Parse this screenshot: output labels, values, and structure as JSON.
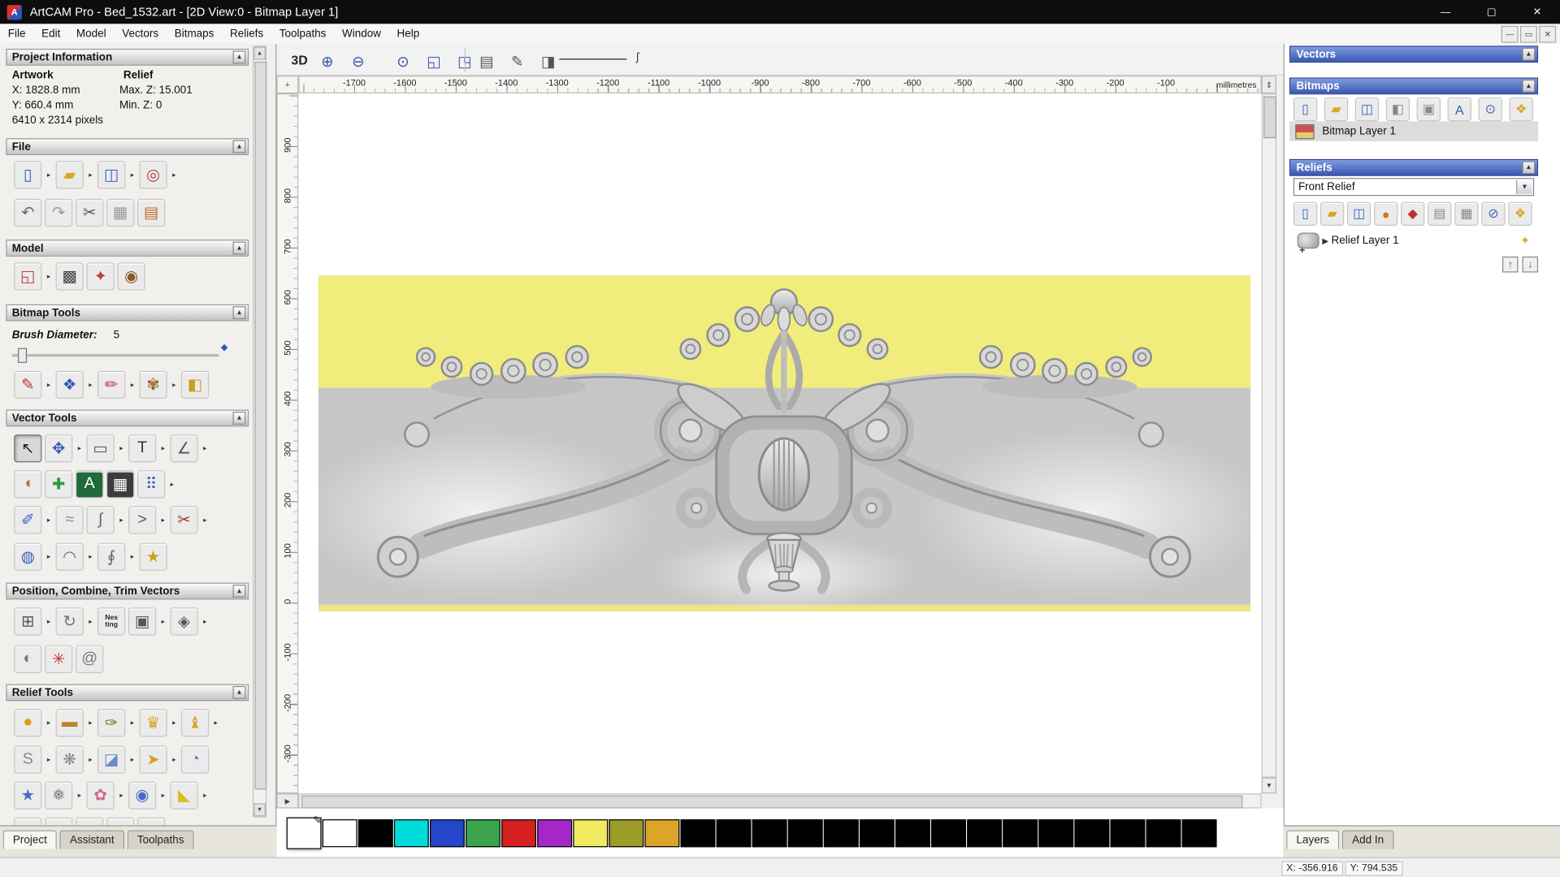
{
  "window": {
    "title": "ArtCAM Pro - Bed_1532.art - [2D View:0 - Bitmap Layer 1]",
    "menus": [
      "File",
      "Edit",
      "Model",
      "Vectors",
      "Bitmaps",
      "Reliefs",
      "Toolpaths",
      "Window",
      "Help"
    ],
    "controls": {
      "minimize": "—",
      "maximize": "▢",
      "close": "✕"
    },
    "mdi_controls": {
      "minimize": "—",
      "restore": "▭",
      "close": "✕"
    }
  },
  "left_panel": {
    "project_info": {
      "title": "Project Information",
      "artwork_label": "Artwork",
      "relief_label": "Relief",
      "x_value": "X: 1828.8 mm",
      "y_value": "Y: 660.4 mm",
      "pixels": "6410 x 2314 pixels",
      "max_z": "Max. Z: 15.001",
      "min_z": "Min. Z: 0"
    },
    "section_titles": {
      "file": "File",
      "model": "Model",
      "bitmap_tools": "Bitmap Tools",
      "vector_tools": "Vector Tools",
      "position_combine": "Position, Combine, Trim Vectors",
      "relief_tools": "Relief Tools"
    },
    "brush": {
      "label": "Brush Diameter:",
      "value": "5"
    },
    "icons": {
      "file_row1": [
        {
          "name": "new-model",
          "glyph": "▯",
          "fg": "#3a62c0",
          "dd": true
        },
        {
          "name": "open-model",
          "glyph": "▰",
          "fg": "#d8a826",
          "dd": true
        },
        {
          "name": "save-model",
          "glyph": "◫",
          "fg": "#3a62c0",
          "dd": true
        },
        {
          "name": "export-model",
          "glyph": "◎",
          "fg": "#b04040",
          "dd": true
        }
      ],
      "file_row2": [
        {
          "name": "undo",
          "glyph": "↶",
          "fg": "#6a6a6a"
        },
        {
          "name": "redo",
          "glyph": "↷",
          "fg": "#9a9a9a"
        },
        {
          "name": "cut",
          "glyph": "✂",
          "fg": "#555555"
        },
        {
          "name": "copy",
          "glyph": "▦",
          "fg": "#9a9a9a"
        },
        {
          "name": "paste",
          "glyph": "▤",
          "fg": "#c06a30"
        }
      ],
      "model_row": [
        {
          "name": "set-model-size",
          "glyph": "◱",
          "fg": "#c04040",
          "dd": true
        },
        {
          "name": "adjust-model",
          "glyph": "▩",
          "fg": "#404040"
        },
        {
          "name": "relief-clipart-library",
          "glyph": "✦",
          "fg": "#c04040"
        },
        {
          "name": "model-texture",
          "glyph": "◉",
          "fg": "#8a5a2a"
        }
      ],
      "bitmap_row": [
        {
          "name": "paint",
          "glyph": "✎",
          "fg": "#c03030",
          "dd": true
        },
        {
          "name": "paint-selective-colour",
          "glyph": "❖",
          "fg": "#3858b8",
          "dd": true
        },
        {
          "name": "pixel-edit",
          "glyph": "✏",
          "fg": "#b04040",
          "dd": true
        },
        {
          "name": "colour-palette",
          "glyph": "✾",
          "fg": "#9a6a2a",
          "dd": true
        },
        {
          "name": "flood-fill",
          "glyph": "◧",
          "fg": "#c8a020"
        }
      ],
      "vector_row1": [
        {
          "name": "select-vectors",
          "glyph": "↖",
          "fg": "#222222",
          "pressed": true
        },
        {
          "name": "transform-vectors",
          "glyph": "✥",
          "fg": "#3858b8",
          "dd": true
        },
        {
          "name": "create-rectangle",
          "glyph": "▭",
          "fg": "#555555",
          "dd": true
        },
        {
          "name": "create-text",
          "glyph": "T",
          "fg": "#333333",
          "dd": true
        },
        {
          "name": "measure",
          "glyph": "∠",
          "fg": "#555555",
          "dd": true
        }
      ],
      "vector_row2": [
        {
          "name": "create-vector-offset",
          "glyph": "◖",
          "fg": "#c07030"
        },
        {
          "name": "vector-doctor",
          "glyph": "✚",
          "fg": "#2a9a3a"
        },
        {
          "name": "convert-text-to-vectors",
          "glyph": "A",
          "fg": "#ffffff",
          "bg": "#1f6b3a"
        },
        {
          "name": "paste-along-curve",
          "glyph": "▦",
          "fg": "#ffffff",
          "bg": "#3c3c3c"
        },
        {
          "name": "block-copy",
          "glyph": "⠿",
          "fg": "#3858b8",
          "dd": true
        }
      ],
      "vector_row3": [
        {
          "name": "create-polyline",
          "glyph": "✐",
          "fg": "#3060c0",
          "dd": true
        },
        {
          "name": "fit-arcs",
          "glyph": "≈",
          "fg": "#909090"
        },
        {
          "name": "create-bezier",
          "glyph": "∫",
          "fg": "#666666",
          "dd": true
        },
        {
          "name": "join-close-vectors",
          "glyph": ">",
          "fg": "#555555",
          "dd": true
        },
        {
          "name": "trim-vectors",
          "glyph": "✂",
          "fg": "#a03030",
          "dd": true
        }
      ],
      "vector_row4": [
        {
          "name": "create-circle",
          "glyph": "◍",
          "fg": "#3a62b0",
          "dd": true
        },
        {
          "name": "create-arc",
          "glyph": "◠",
          "fg": "#666666",
          "dd": true
        },
        {
          "name": "node-editing",
          "glyph": "∮",
          "fg": "#666666",
          "dd": true
        },
        {
          "name": "create-star",
          "glyph": "★",
          "fg": "#c8a018"
        }
      ],
      "position_row1": [
        {
          "name": "align-vectors",
          "glyph": "⊞",
          "fg": "#555555",
          "dd": true
        },
        {
          "name": "paste-in-circle",
          "glyph": "↻",
          "fg": "#777777",
          "dd": true
        },
        {
          "name": "nesting",
          "glyph": "Nes\nting",
          "fg": "#222222",
          "small": true
        },
        {
          "name": "group-vectors",
          "glyph": "▣",
          "fg": "#555555",
          "dd": true
        },
        {
          "name": "weld-vectors",
          "glyph": "◈",
          "fg": "#555555",
          "dd": true
        }
      ],
      "position_row2": [
        {
          "name": "mirror-vectors",
          "glyph": "◐",
          "fg": "#777777"
        },
        {
          "name": "slice-vectors",
          "glyph": "✳",
          "fg": "#c03030"
        },
        {
          "name": "create-spiral",
          "glyph": "@",
          "fg": "#777777"
        }
      ],
      "relief_row1": [
        {
          "name": "shape-editor",
          "glyph": "●",
          "fg": "#d8a020",
          "dd": true
        },
        {
          "name": "smooth-relief",
          "glyph": "▬",
          "fg": "#b8862a",
          "dd": true
        },
        {
          "name": "sculpt",
          "glyph": "✑",
          "fg": "#8a6a2a",
          "dd": true
        },
        {
          "name": "add-relief-clipart",
          "glyph": "♛",
          "fg": "#d8a020",
          "dd": true
        },
        {
          "name": "spin-relief",
          "glyph": "♝",
          "fg": "#d8a020",
          "dd": true
        }
      ],
      "relief_row2": [
        {
          "name": "two-rail-sweep",
          "glyph": "S",
          "fg": "#888888",
          "dd": true
        },
        {
          "name": "weave-wizard",
          "glyph": "❋",
          "fg": "#888888",
          "dd": true
        },
        {
          "name": "envelope-distort",
          "glyph": "◪",
          "fg": "#6a8ac8",
          "dd": true
        },
        {
          "name": "extrude",
          "glyph": "➤",
          "fg": "#d8a020",
          "dd": true
        },
        {
          "name": "unwrap-relief",
          "glyph": "◔",
          "fg": "#6a8ac8"
        }
      ],
      "relief_row3": [
        {
          "name": "texture-star",
          "glyph": "★",
          "fg": "#4a6ac8"
        },
        {
          "name": "texture-relief",
          "glyph": "❅",
          "fg": "#888888",
          "dd": true
        },
        {
          "name": "feather-relief",
          "glyph": "✿",
          "fg": "#d06a8a",
          "dd": true
        },
        {
          "name": "isoform",
          "glyph": "◉",
          "fg": "#4a6ac8",
          "dd": true
        },
        {
          "name": "create-wedge",
          "glyph": "◣",
          "fg": "#d8c020",
          "dd": true
        }
      ],
      "relief_row4": [
        {
          "name": "offset-relief",
          "glyph": "●",
          "fg": "#c03030"
        },
        {
          "name": "greyscale-from-relief",
          "glyph": "▦",
          "fg": "#888888"
        },
        {
          "name": "relief-from-image",
          "glyph": "◍",
          "fg": "#4a6ac8"
        },
        {
          "name": "mirror-relief",
          "glyph": "◨",
          "fg": "#888888"
        },
        {
          "name": "combine-relief",
          "glyph": "◩",
          "fg": "#888888"
        }
      ]
    },
    "tabs": [
      {
        "label": "Project",
        "active": true
      },
      {
        "label": "Assistant",
        "active": false
      },
      {
        "label": "Toolpaths",
        "active": false
      }
    ]
  },
  "toolbar": {
    "mode_3d": "3D",
    "zoom_icons_a": [
      {
        "name": "zoom-in",
        "glyph": "⊕",
        "fg": "#3858a8"
      },
      {
        "name": "zoom-out",
        "glyph": "⊖",
        "fg": "#3858a8"
      }
    ],
    "zoom_icons_b": [
      {
        "name": "zoom-previous",
        "glyph": "⊙",
        "fg": "#3858a8"
      },
      {
        "name": "zoom-fit",
        "glyph": "◱",
        "fg": "#3858a8"
      },
      {
        "name": "zoom-objects",
        "glyph": "◳",
        "fg": "#3858a8"
      }
    ],
    "view_icons": [
      {
        "name": "show-bitmap",
        "glyph": "▤",
        "fg": "#555555"
      },
      {
        "name": "show-vectors",
        "glyph": "✎",
        "fg": "#555555"
      },
      {
        "name": "show-relief-preview",
        "glyph": "◨",
        "fg": "#555555"
      }
    ]
  },
  "canvas": {
    "ruler_unit": "millimetres",
    "h_ticks": [
      "-1700",
      "-1600",
      "-1500",
      "-1400",
      "-1300",
      "-1200",
      "-1100",
      "-1000",
      "-900",
      "-800",
      "-700",
      "-600",
      "-500",
      "-400",
      "-300",
      "-200",
      "-100"
    ],
    "v_ticks": [
      "900",
      "800",
      "700",
      "600",
      "500",
      "400",
      "300",
      "200",
      "100",
      "0",
      "-100",
      "-200",
      "-300"
    ]
  },
  "right_panel": {
    "vectors_title": "Vectors",
    "bitmaps_title": "Bitmaps",
    "bitmap_layer_name": "Bitmap Layer 1",
    "reliefs_title": "Reliefs",
    "relief_combo_value": "Front Relief",
    "relief_layer_name": "Relief Layer 1",
    "bitmap_icons": [
      {
        "name": "new-bitmap",
        "glyph": "▯",
        "fg": "#3a62c0"
      },
      {
        "name": "load-bitmap",
        "glyph": "▰",
        "fg": "#d8a826"
      },
      {
        "name": "save-bitmap",
        "glyph": "◫",
        "fg": "#3a62c0"
      },
      {
        "name": "bitmap-contrast",
        "glyph": "◧",
        "fg": "#888888"
      },
      {
        "name": "bitmap-merge",
        "glyph": "▣",
        "fg": "#888888"
      },
      {
        "name": "bitmap-to-vector",
        "glyph": "A",
        "fg": "#3858b8"
      },
      {
        "name": "colour-link",
        "glyph": "⊙",
        "fg": "#3a62b0"
      },
      {
        "name": "bitmap-options",
        "glyph": "❖",
        "fg": "#d8a826"
      }
    ],
    "relief_icons": [
      {
        "name": "new-relief",
        "glyph": "▯",
        "fg": "#3a62c0"
      },
      {
        "name": "load-relief",
        "glyph": "▰",
        "fg": "#d8a826"
      },
      {
        "name": "save-relief",
        "glyph": "◫",
        "fg": "#3a62c0"
      },
      {
        "name": "smooth-relief",
        "glyph": "●",
        "fg": "#c87820"
      },
      {
        "name": "calculate-relief",
        "glyph": "◆",
        "fg": "#c03030"
      },
      {
        "name": "relief-preview",
        "glyph": "▤",
        "fg": "#888888"
      },
      {
        "name": "relief-calculator",
        "glyph": "▦",
        "fg": "#888888"
      },
      {
        "name": "delete-relief",
        "glyph": "⊘",
        "fg": "#3a62b0"
      },
      {
        "name": "relief-options",
        "glyph": "❖",
        "fg": "#d8a826"
      }
    ],
    "tabs": [
      {
        "label": "Layers",
        "active": true
      },
      {
        "label": "Add In",
        "active": false
      }
    ]
  },
  "palette": {
    "colors": [
      "#ffffff",
      "#ffffff",
      "#000000",
      "#00dcdc",
      "#2446c8",
      "#3ca44c",
      "#d42020",
      "#a428c8",
      "#f0ea60",
      "#9c9c28",
      "#dca428",
      "#000000",
      "#000000",
      "#000000",
      "#000000",
      "#000000",
      "#000000",
      "#000000",
      "#000000",
      "#000000",
      "#000000",
      "#000000",
      "#000000",
      "#000000",
      "#000000",
      "#000000"
    ]
  },
  "status_bar": {
    "x": "X: -356.916",
    "y": "Y: 794.535"
  }
}
